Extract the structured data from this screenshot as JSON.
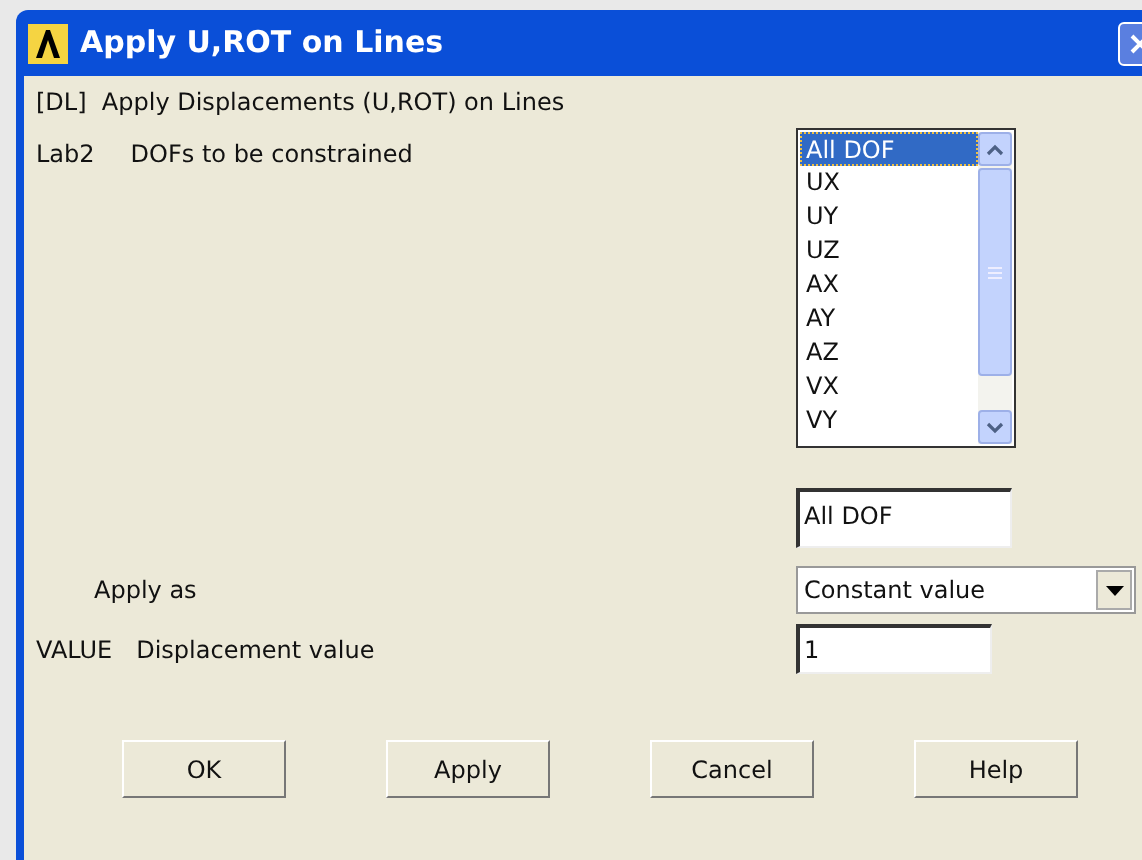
{
  "window": {
    "title": "Apply U,ROT on Lines"
  },
  "header": "[DL]  Apply Displacements (U,ROT) on Lines",
  "dof_list": {
    "code": "Lab2",
    "label": "DOFs to be constrained",
    "items": [
      {
        "label": "All DOF",
        "selected": true
      },
      {
        "label": "UX",
        "selected": false
      },
      {
        "label": "UY",
        "selected": false
      },
      {
        "label": "UZ",
        "selected": false
      },
      {
        "label": "AX",
        "selected": false
      },
      {
        "label": "AY",
        "selected": false
      },
      {
        "label": "AZ",
        "selected": false
      },
      {
        "label": "VX",
        "selected": false
      },
      {
        "label": "VY",
        "selected": false
      }
    ]
  },
  "selection_field": {
    "value": "All DOF"
  },
  "apply_as": {
    "label": "Apply as",
    "value": "Constant value"
  },
  "value_field": {
    "code": "VALUE",
    "label": "Displacement value",
    "value": "1"
  },
  "buttons": [
    "OK",
    "Apply",
    "Cancel",
    "Help"
  ]
}
